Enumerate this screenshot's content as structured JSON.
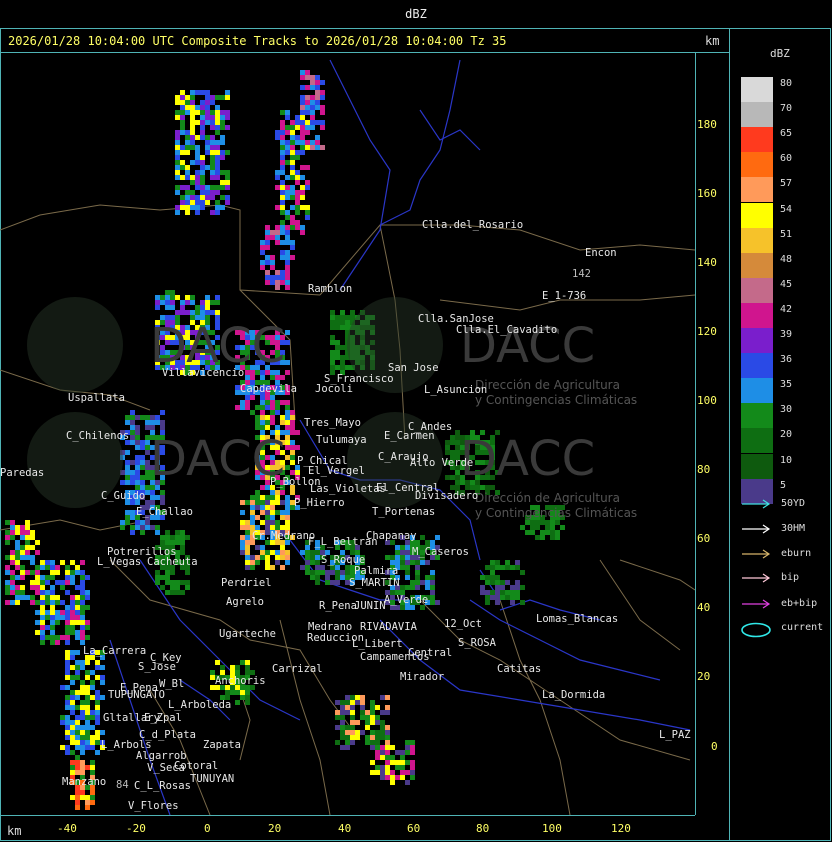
{
  "window": {
    "title": "dBZ"
  },
  "header": {
    "text": "2026/01/28 10:04:00 UTC Composite Tracks to 2026/01/28 10:04:00 Tz 35",
    "km_top": "km",
    "km_bottom": "km"
  },
  "axes": {
    "y_ticks": [
      "180",
      "160",
      "140",
      "120",
      "100",
      "80",
      "60",
      "40",
      "20",
      "0"
    ],
    "x_ticks": [
      "-40",
      "-20",
      "0",
      "20",
      "40",
      "60",
      "80",
      "100",
      "120"
    ]
  },
  "watermark": {
    "brand": "DACC",
    "line1": "Dirección de Agricultura",
    "line2": "y Contingencias Climáticas"
  },
  "places": [
    "Clla.del_Rosario",
    "Encon",
    "142",
    "E_1-736",
    "Ramblon",
    "Clla.SanJose",
    "Clla.El_Cavadito",
    "S_Francisco",
    "San Jose",
    "L_Asuncion",
    "Uspallata",
    "Villavicencio",
    "Capdevila",
    "C_Chilenos",
    "Tres_Mayo",
    "Jocoli",
    "Tulumaya",
    "E_Carmen",
    "C_Andes",
    "C_Araujo",
    "Alto Verde",
    "Paredas",
    "P_Chical",
    "El_Vergel",
    "P_Bollon",
    "Las_Violetas",
    "El_Central",
    "Divisadero",
    "C_Guido",
    "E_Challao",
    "P_Hierro",
    "T_Portenas",
    "Cr.Medrano",
    "F_L_Beltran",
    "Chapanay",
    "M_Caseros",
    "Potrerillos",
    "L_Vegas",
    "Cacheuta",
    "S_Roque",
    "Palmira",
    "S_MARTIN",
    "Perdriel",
    "Agrelo",
    "R_Pena",
    "JUNIN",
    "A_Verde",
    "Ugarteche",
    "Medrano",
    "RIVADAVIA",
    "12_Oct",
    "Reduccion",
    "L_Libert",
    "S_ROSA",
    "Lomas_Blancas",
    "La_Carrera",
    "C_Key",
    "S_Jose",
    "Carrizal",
    "Campamentos",
    "Central",
    "Catitas",
    "Anchoris",
    "E_Pena",
    "TUPUNGATO",
    "Mirador",
    "W_Bl",
    "La_Dormida",
    "L_Arboleda",
    "Gltallary",
    "E_Zpal",
    "C_d_Plata",
    "L_Arbols",
    "Zapata",
    "L_PAZ",
    "Algarrob",
    "Cotoral",
    "V_Seca",
    "TUNUYAN",
    "Manzano",
    "C_L_Rosas",
    "V_Flores",
    "84"
  ],
  "legend": {
    "title": "dBZ",
    "levels": [
      {
        "label": "80",
        "color": "#d9d9d9"
      },
      {
        "label": "70",
        "color": "#b8b8b8"
      },
      {
        "label": "65",
        "color": "#ff3a1e"
      },
      {
        "label": "60",
        "color": "#ff6a10"
      },
      {
        "label": "57",
        "color": "#ff9a5a"
      },
      {
        "label": "54",
        "color": "#ffff00"
      },
      {
        "label": "51",
        "color": "#f6c22a"
      },
      {
        "label": "48",
        "color": "#d58a3a"
      },
      {
        "label": "45",
        "color": "#c46a8a"
      },
      {
        "label": "42",
        "color": "#d0158e"
      },
      {
        "label": "39",
        "color": "#7a1ecc"
      },
      {
        "label": "36",
        "color": "#2a4ae6"
      },
      {
        "label": "35",
        "color": "#1e8ee6"
      },
      {
        "label": "30",
        "color": "#138a1a"
      },
      {
        "label": "20",
        "color": "#0e6e12"
      },
      {
        "label": "10",
        "color": "#0e5a0e"
      },
      {
        "label": "5",
        "color": "#4a3a8a"
      }
    ],
    "tracks": [
      {
        "label": "50YD",
        "color": "#40e0e0"
      },
      {
        "label": "30HM",
        "color": "#ffffff"
      },
      {
        "label": "eburn",
        "color": "#d6b46a"
      },
      {
        "label": "bip",
        "color": "#ffc8d8"
      },
      {
        "label": "eb+bip",
        "color": "#e040e0"
      },
      {
        "label": "current",
        "color": "#30e8e8"
      }
    ]
  }
}
